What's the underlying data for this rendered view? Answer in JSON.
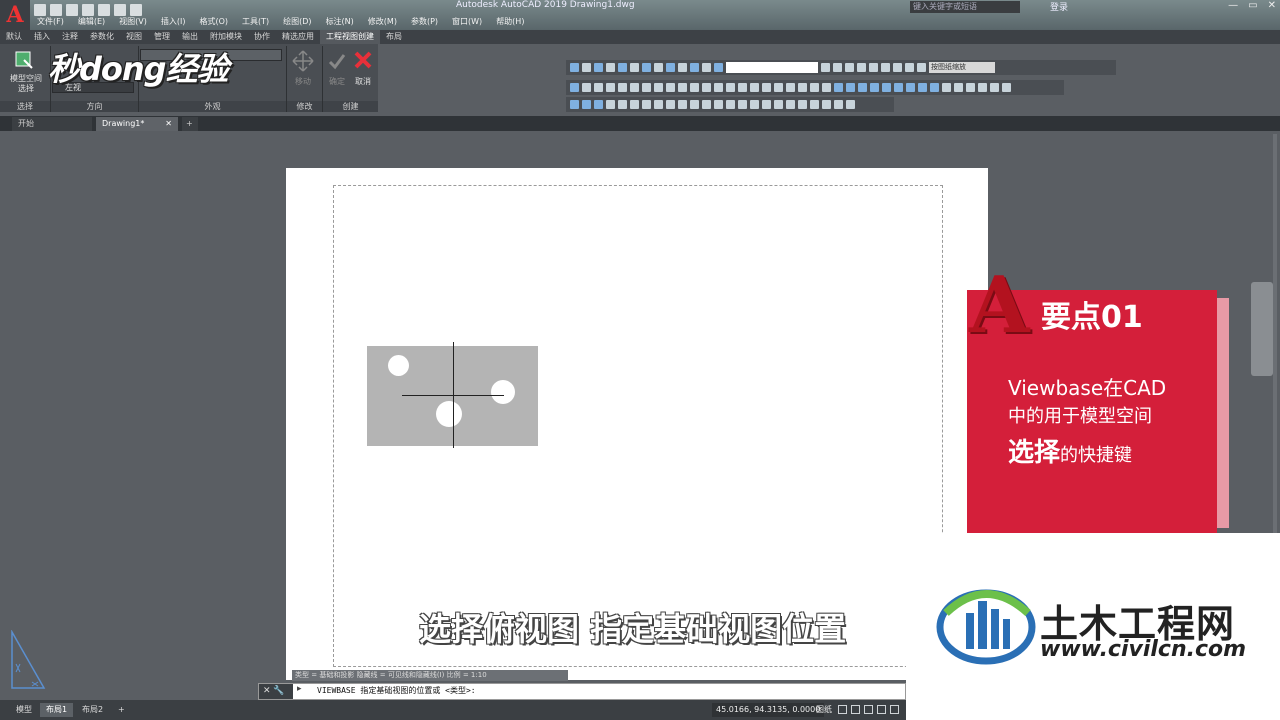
{
  "window": {
    "app_button": "A",
    "title": "Autodesk AutoCAD 2019    Drawing1.dwg",
    "search_placeholder": "键入关键字或短语",
    "login": "登录",
    "controls": [
      "—",
      "▭",
      "✕"
    ]
  },
  "menu": [
    "文件(F)",
    "编辑(E)",
    "视图(V)",
    "插入(I)",
    "格式(O)",
    "工具(T)",
    "绘图(D)",
    "标注(N)",
    "修改(M)",
    "参数(P)",
    "窗口(W)",
    "帮助(H)"
  ],
  "ribbon_tabs": [
    "默认",
    "插入",
    "注释",
    "参数化",
    "视图",
    "管理",
    "输出",
    "附加模块",
    "协作",
    "精选应用",
    "工程视图创建",
    "布局"
  ],
  "ribbon": {
    "select_button": "模型空间\n选择",
    "orientation_value": "左视",
    "panels": [
      "选择",
      "方向",
      "外观",
      "修改",
      "创建"
    ],
    "move_label": "移动",
    "ok_label": "确定",
    "cancel_label": "取消"
  },
  "watermark_logo": "秒dong经验",
  "toolbar": {
    "scale_label": "按图纸缩放"
  },
  "doc_tabs": {
    "start": "开始",
    "drawing": "Drawing1*",
    "close": "✕",
    "new": "+"
  },
  "card": {
    "letter": "A",
    "title": "要点01",
    "line1": "Viewbase在CAD",
    "line2": "中的用于模型空间",
    "line3_bold": "选择",
    "line3_rest": "的快捷键"
  },
  "subtitle": "选择俯视图 指定基础视图位置",
  "site_logo": {
    "name": "土木工程网",
    "url": "www.civilcn.com"
  },
  "command": {
    "info": "类型 = 基础和投影  隐藏线 = 可见线和隐藏线(I)  比例 = 1:10",
    "controls": "✕ 🔧",
    "text": "VIEWBASE 指定基础视图的位置或  <类型>:"
  },
  "status": {
    "tabs": [
      "模型",
      "布局1",
      "布局2",
      "+"
    ],
    "coords": "45.0166, 94.3135, 0.0000",
    "paper": "图纸"
  },
  "colors": {
    "card_red": "#d41f3a",
    "canvas_bg": "#5a5e63",
    "view_gray": "#b4b4b4"
  }
}
